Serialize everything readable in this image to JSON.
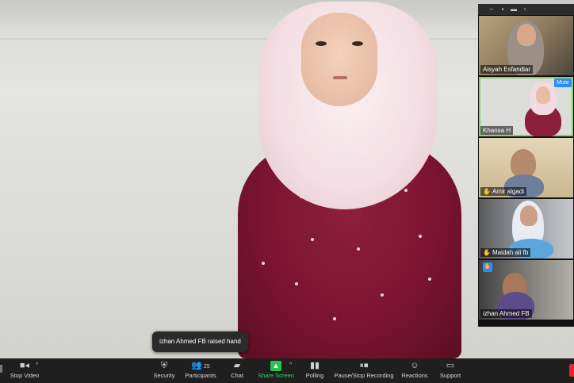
{
  "gallery": {
    "tiles": [
      {
        "name": "Aisyah Esfandiar"
      },
      {
        "name": "Khansa H",
        "mute_label": "Mute"
      },
      {
        "name": "Amir algadi"
      },
      {
        "name": "Maidah   ali  fb"
      },
      {
        "name": "izhan  Ahmed FB"
      }
    ]
  },
  "notification": {
    "text": "izhan  Ahmed FB raised hand"
  },
  "toolbar": {
    "stop_video": "Stop Video",
    "security": "Security",
    "participants": "Participants",
    "participants_count": "25",
    "chat": "Chat",
    "share_screen": "Share Screen",
    "polling": "Polling",
    "recording": "Pause/Stop Recording",
    "reactions": "Reactions",
    "support": "Support"
  },
  "colors": {
    "accent_blue": "#2d8cff",
    "active_speaker": "#7fd36a",
    "share_green": "#2fbf4f",
    "end_red": "#e02828"
  }
}
